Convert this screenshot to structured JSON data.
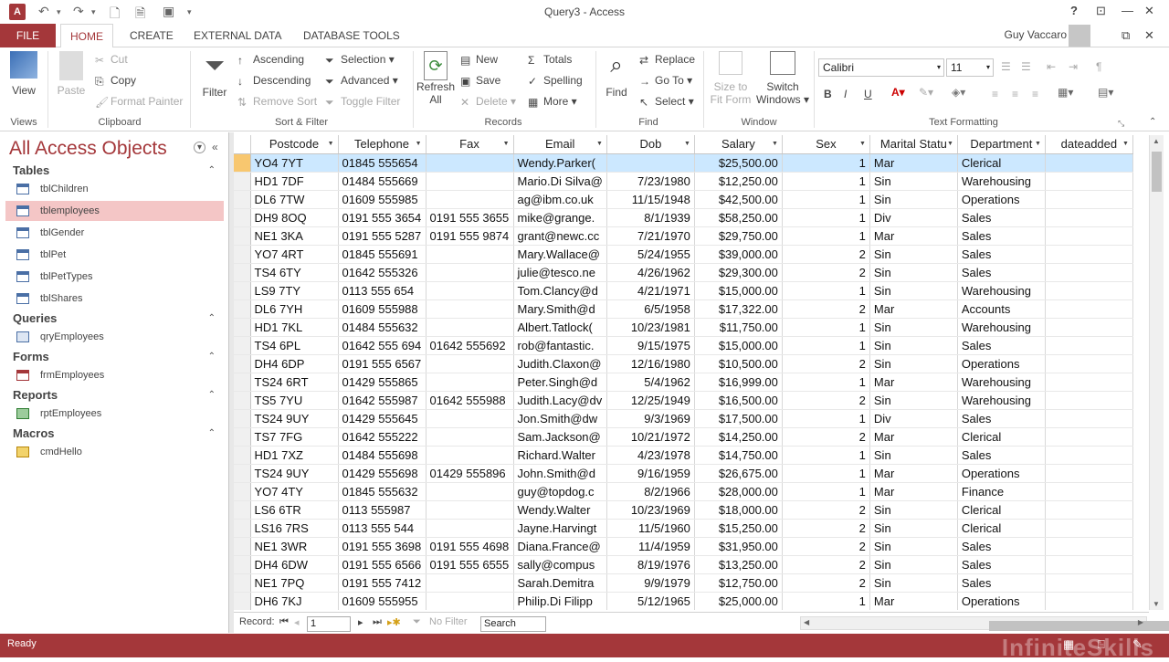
{
  "app": {
    "icon_letter": "A",
    "title": "Query3 - Access",
    "user": "Guy Vaccaro",
    "help": "?"
  },
  "tabs": [
    "FILE",
    "HOME",
    "CREATE",
    "EXTERNAL DATA",
    "DATABASE TOOLS"
  ],
  "ribbon": {
    "views": {
      "view": "View",
      "label": "Views"
    },
    "clipboard": {
      "paste": "Paste",
      "cut": "Cut",
      "copy": "Copy",
      "format_painter": "Format Painter",
      "label": "Clipboard"
    },
    "sort_filter": {
      "filter": "Filter",
      "ascending": "Ascending",
      "descending": "Descending",
      "remove_sort": "Remove Sort",
      "selection": "Selection",
      "advanced": "Advanced",
      "toggle_filter": "Toggle Filter",
      "label": "Sort & Filter"
    },
    "records": {
      "refresh": "Refresh",
      "refresh2": "All",
      "new": "New",
      "save": "Save",
      "delete": "Delete",
      "totals": "Totals",
      "spelling": "Spelling",
      "more": "More",
      "label": "Records"
    },
    "find": {
      "find": "Find",
      "replace": "Replace",
      "goto": "Go To",
      "select": "Select",
      "label": "Find"
    },
    "window": {
      "size_to": "Size to",
      "fit_form": "Fit Form",
      "switch": "Switch",
      "windows": "Windows",
      "label": "Window"
    },
    "text_formatting": {
      "font": "Calibri",
      "size": "11",
      "bold": "B",
      "italic": "I",
      "underline": "U",
      "label": "Text Formatting"
    }
  },
  "nav": {
    "title": "All Access Objects",
    "sections": [
      {
        "name": "Tables",
        "items": [
          "tblChildren",
          "tblemployees",
          "tblGender",
          "tblPet",
          "tblPetTypes",
          "tblShares"
        ]
      },
      {
        "name": "Queries",
        "items": [
          "qryEmployees"
        ]
      },
      {
        "name": "Forms",
        "items": [
          "frmEmployees"
        ]
      },
      {
        "name": "Reports",
        "items": [
          "rptEmployees"
        ]
      },
      {
        "name": "Macros",
        "items": [
          "cmdHello"
        ]
      }
    ]
  },
  "grid": {
    "columns": [
      "Postcode",
      "Telephone",
      "Fax",
      "Email",
      "Dob",
      "Salary",
      "Sex",
      "Marital Statu",
      "Department",
      "dateadded"
    ],
    "rows": [
      [
        "YO4 7YT",
        "01845 555654",
        "",
        "Wendy.Parker(",
        "",
        "$25,500.00",
        "1",
        "Mar",
        "Clerical",
        ""
      ],
      [
        "HD1 7DF",
        "01484 555669",
        "",
        "Mario.Di Silva@",
        "7/23/1980",
        "$12,250.00",
        "1",
        "Sin",
        "Warehousing",
        ""
      ],
      [
        "DL6 7TW",
        "01609 555985",
        "",
        "ag@ibm.co.uk",
        "11/15/1948",
        "$42,500.00",
        "1",
        "Sin",
        "Operations",
        ""
      ],
      [
        "DH9 8OQ",
        "0191 555 3654",
        "0191 555 3655",
        "mike@grange.",
        "8/1/1939",
        "$58,250.00",
        "1",
        "Div",
        "Sales",
        ""
      ],
      [
        "NE1 3KA",
        "0191 555 5287",
        "0191 555 9874",
        "grant@newc.cc",
        "7/21/1970",
        "$29,750.00",
        "1",
        "Mar",
        "Sales",
        ""
      ],
      [
        "YO7 4RT",
        "01845 555691",
        "",
        "Mary.Wallace@",
        "5/24/1955",
        "$39,000.00",
        "2",
        "Sin",
        "Sales",
        ""
      ],
      [
        "TS4 6TY",
        "01642 555326",
        "",
        "julie@tesco.ne",
        "4/26/1962",
        "$29,300.00",
        "2",
        "Sin",
        "Sales",
        ""
      ],
      [
        "LS9 7TY",
        "0113 555 654",
        "",
        "Tom.Clancy@d",
        "4/21/1971",
        "$15,000.00",
        "1",
        "Sin",
        "Warehousing",
        ""
      ],
      [
        "DL6 7YH",
        "01609 555988",
        "",
        "Mary.Smith@d",
        "6/5/1958",
        "$17,322.00",
        "2",
        "Mar",
        "Accounts",
        ""
      ],
      [
        "HD1 7KL",
        "01484 555632",
        "",
        "Albert.Tatlock(",
        "10/23/1981",
        "$11,750.00",
        "1",
        "Sin",
        "Warehousing",
        ""
      ],
      [
        "TS4 6PL",
        "01642 555 694",
        "01642 555692",
        "rob@fantastic.",
        "9/15/1975",
        "$15,000.00",
        "1",
        "Sin",
        "Sales",
        ""
      ],
      [
        "DH4 6DP",
        "0191 555 6567",
        "",
        "Judith.Claxon@",
        "12/16/1980",
        "$10,500.00",
        "2",
        "Sin",
        "Operations",
        ""
      ],
      [
        "TS24 6RT",
        "01429 555865",
        "",
        "Peter.Singh@d",
        "5/4/1962",
        "$16,999.00",
        "1",
        "Mar",
        "Warehousing",
        ""
      ],
      [
        "TS5 7YU",
        "01642 555987",
        "01642 555988",
        "Judith.Lacy@dv",
        "12/25/1949",
        "$16,500.00",
        "2",
        "Sin",
        "Warehousing",
        ""
      ],
      [
        "TS24 9UY",
        "01429 555645",
        "",
        "Jon.Smith@dw",
        "9/3/1969",
        "$17,500.00",
        "1",
        "Div",
        "Sales",
        ""
      ],
      [
        "TS7 7FG",
        "01642 555222",
        "",
        "Sam.Jackson@",
        "10/21/1972",
        "$14,250.00",
        "2",
        "Mar",
        "Clerical",
        ""
      ],
      [
        "HD1 7XZ",
        "01484 555698",
        "",
        "Richard.Walter",
        "4/23/1978",
        "$14,750.00",
        "1",
        "Sin",
        "Sales",
        ""
      ],
      [
        "TS24 9UY",
        "01429 555698",
        "01429 555896",
        "John.Smith@d",
        "9/16/1959",
        "$26,675.00",
        "1",
        "Mar",
        "Operations",
        ""
      ],
      [
        "YO7 4TY",
        "01845 555632",
        "",
        "guy@topdog.c",
        "8/2/1966",
        "$28,000.00",
        "1",
        "Mar",
        "Finance",
        ""
      ],
      [
        "LS6 6TR",
        "0113 555987",
        "",
        "Wendy.Walter",
        "10/23/1969",
        "$18,000.00",
        "2",
        "Sin",
        "Clerical",
        ""
      ],
      [
        "LS16 7RS",
        "0113 555 544",
        "",
        "Jayne.Harvingt",
        "11/5/1960",
        "$15,250.00",
        "2",
        "Sin",
        "Clerical",
        ""
      ],
      [
        "NE1 3WR",
        "0191 555 3698",
        "0191 555 4698",
        "Diana.France@",
        "11/4/1959",
        "$31,950.00",
        "2",
        "Sin",
        "Sales",
        ""
      ],
      [
        "DH4 6DW",
        "0191 555 6566",
        "0191 555 6555",
        "sally@compus",
        "8/19/1976",
        "$13,250.00",
        "2",
        "Sin",
        "Sales",
        ""
      ],
      [
        "NE1 7PQ",
        "0191 555 7412",
        "",
        "Sarah.Demitra",
        "9/9/1979",
        "$12,750.00",
        "2",
        "Sin",
        "Sales",
        ""
      ],
      [
        "DH6 7KJ",
        "01609 555955",
        "",
        "Philip.Di Filipp",
        "5/12/1965",
        "$25,000.00",
        "1",
        "Mar",
        "Operations",
        ""
      ]
    ]
  },
  "recnav": {
    "label": "Record:",
    "current": "1",
    "no_filter": "No Filter",
    "search": "Search"
  },
  "status": {
    "text": "Ready",
    "watermark": "InfiniteSkills"
  }
}
